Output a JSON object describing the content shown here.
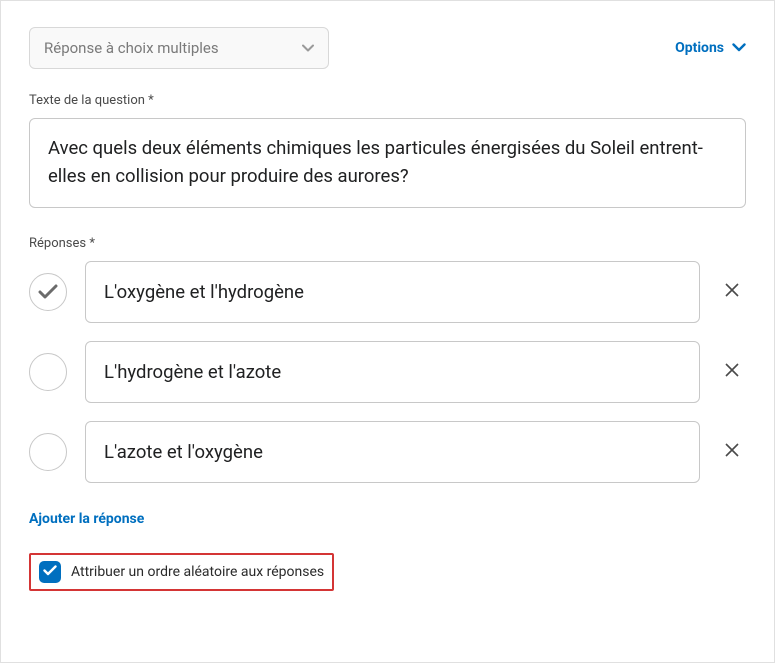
{
  "questionType": {
    "selected": "Réponse à choix multiples"
  },
  "optionsLink": "Options",
  "labels": {
    "questionText": "Texte de la question *",
    "answers": "Réponses *"
  },
  "question": "Avec quels deux éléments chimiques les particules énergisées du Soleil entrent-elles en collision pour produire des aurores?",
  "answers": [
    {
      "text": "L'oxygène et l'hydrogène",
      "correct": true
    },
    {
      "text": "L'hydrogène et l'azote",
      "correct": false
    },
    {
      "text": "L'azote et l'oxygène",
      "correct": false
    }
  ],
  "addAnswer": "Ajouter la réponse",
  "randomize": {
    "label": "Attribuer un ordre aléatoire aux réponses",
    "checked": true
  }
}
